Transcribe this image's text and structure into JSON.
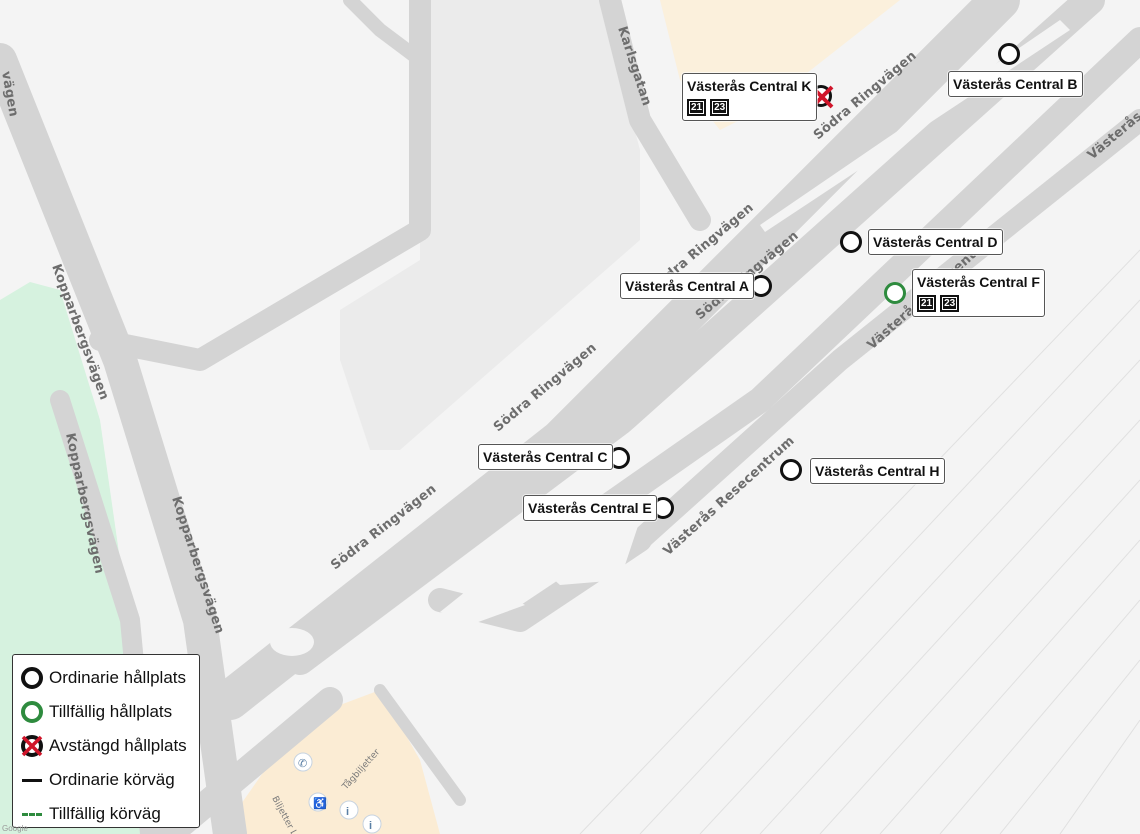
{
  "roads": [
    {
      "name": "Karlsgatan"
    },
    {
      "name": "Södra Ringvägen"
    },
    {
      "name": "Södra Ringvägen"
    },
    {
      "name": "Södra Ringvägen"
    },
    {
      "name": "Södra Ringvägen"
    },
    {
      "name": "Södra Ringvägen"
    },
    {
      "name": "Kopparbergsvägen"
    },
    {
      "name": "Kopparbergsvägen"
    },
    {
      "name": "Kopparbergsvägen"
    },
    {
      "name": "Västerås Resecentrum"
    },
    {
      "name": "Västerås Resecentrum"
    },
    {
      "name": "Västerås Resecentrum"
    },
    {
      "name": "vägen"
    },
    {
      "name": "Södra Ringvägen"
    }
  ],
  "pois": {
    "tagbiljetter": "Tågbiljetter",
    "biljetter": "Biljetter Länstrafik"
  },
  "stops": [
    {
      "name": "Västerås Central K",
      "status": "closed",
      "lines": [
        "21",
        "23"
      ]
    },
    {
      "name": "Västerås Central B",
      "status": "ordinary",
      "lines": []
    },
    {
      "name": "Västerås Central D",
      "status": "ordinary",
      "lines": []
    },
    {
      "name": "Västerås Central A",
      "status": "ordinary",
      "lines": []
    },
    {
      "name": "Västerås Central F",
      "status": "temporary",
      "lines": [
        "21",
        "23"
      ]
    },
    {
      "name": "Västerås Central C",
      "status": "ordinary",
      "lines": []
    },
    {
      "name": "Västerås Central H",
      "status": "ordinary",
      "lines": []
    },
    {
      "name": "Västerås Central E",
      "status": "ordinary",
      "lines": []
    }
  ],
  "legend": {
    "ordinary_stop": "Ordinarie hållplats",
    "temporary_stop": "Tillfällig hållplats",
    "closed_stop": "Avstängd hållplats",
    "ordinary_route": "Ordinarie körväg",
    "temporary_route": "Tillfällig körväg"
  },
  "colors": {
    "ordinary": "#111111",
    "temporary": "#2e8b3e",
    "closed_cross": "#d0152a",
    "road": "#d4d4d4",
    "park": "#d6f2df",
    "building": "#ececec",
    "station": "#fbecd4"
  },
  "attribution": "Google"
}
